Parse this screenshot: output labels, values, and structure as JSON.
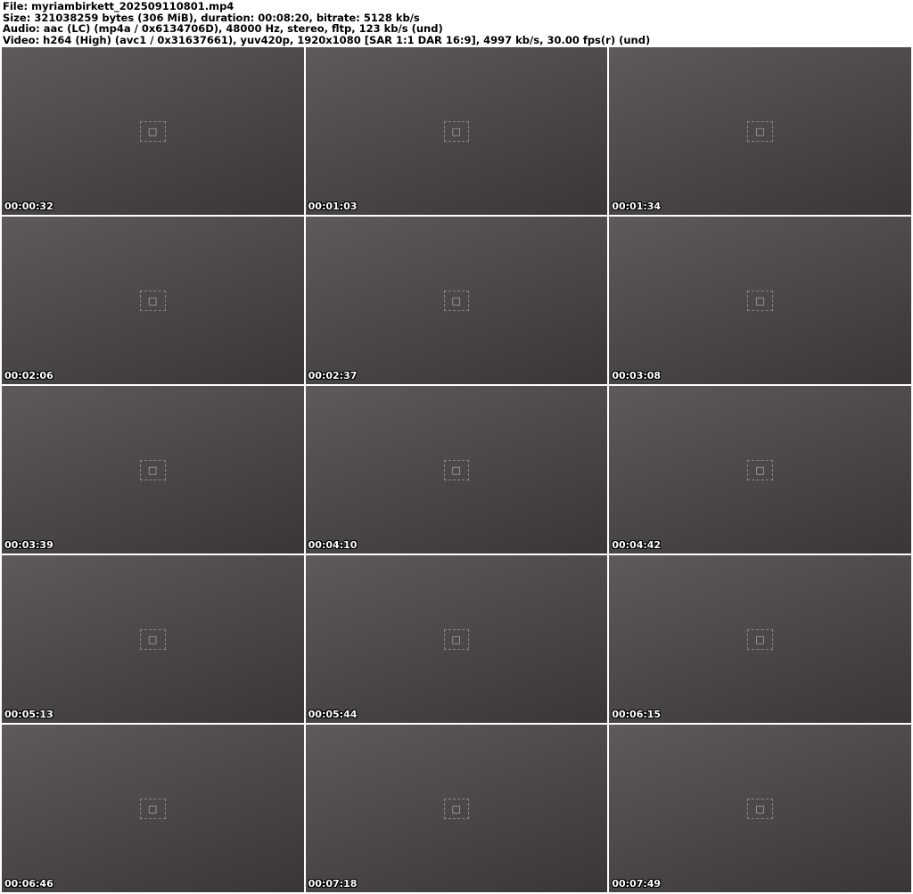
{
  "header": {
    "file": "File: myriambirkett_202509110801.mp4",
    "size": "Size: 321038259 bytes (306 MiB), duration: 00:08:20, bitrate: 5128 kb/s",
    "audio": "Audio: aac (LC) (mp4a / 0x6134706D), 48000 Hz, stereo, fltp, 123 kb/s (und)",
    "video": "Video: h264 (High) (avc1 / 0x31637661), yuv420p, 1920x1080 [SAR 1:1 DAR 16:9], 4997 kb/s, 30.00 fps(r) (und)"
  },
  "thumbnails": [
    {
      "timestamp": "00:00:32"
    },
    {
      "timestamp": "00:01:03"
    },
    {
      "timestamp": "00:01:34"
    },
    {
      "timestamp": "00:02:06"
    },
    {
      "timestamp": "00:02:37"
    },
    {
      "timestamp": "00:03:08"
    },
    {
      "timestamp": "00:03:39"
    },
    {
      "timestamp": "00:04:10"
    },
    {
      "timestamp": "00:04:42"
    },
    {
      "timestamp": "00:05:13"
    },
    {
      "timestamp": "00:05:44"
    },
    {
      "timestamp": "00:06:15"
    },
    {
      "timestamp": "00:06:46"
    },
    {
      "timestamp": "00:07:18"
    },
    {
      "timestamp": "00:07:49"
    }
  ]
}
